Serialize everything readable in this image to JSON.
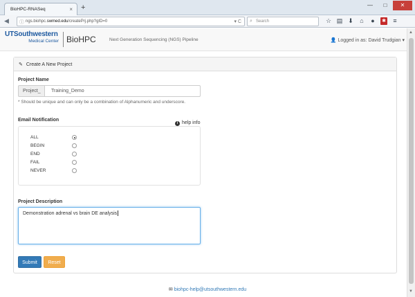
{
  "browser": {
    "tab_title": "BioHPC-RNASeq",
    "tab_close": "×",
    "new_tab": "+",
    "window_buttons": [
      "—",
      "□",
      "✕"
    ],
    "url_prefix": "ngs.biohpc.",
    "url_host": "swmed.edu",
    "url_path": "/createPrj.php?gID=0",
    "url_dropdown": "▾",
    "reload": "C",
    "search_placeholder": "Search",
    "toolbar_icons": [
      "star-icon",
      "clipboard-icon",
      "download-icon",
      "home-icon",
      "chat-icon",
      "addon-icon",
      "menu-icon"
    ]
  },
  "header": {
    "logo_ut": "UTSouthwestern",
    "logo_mc": "Medical Center",
    "brand": "BioHPC",
    "pipeline": "Next Generation Sequencing (NGS) Pipeline",
    "user": "Logged in as: David Trudgian"
  },
  "panel": {
    "title": "Create A New Project",
    "project_name_label": "Project Name",
    "prefix": "Project_",
    "project_name_value": "Training_Demo",
    "project_name_help": "* Should be unique and can only be a combination of Alphanumeric and underscore.",
    "email_label": "Email Notification",
    "help_info": "help info",
    "options": [
      "ALL",
      "BEGIN",
      "END",
      "FAIL",
      "NEVER"
    ],
    "selected_option": "ALL",
    "description_label": "Project Description",
    "description_value": "Demonstration adrenal vs brain DE analysis",
    "submit": "Submit",
    "reset": "Reset"
  },
  "footer": {
    "email": "biohpc-help@utsouthwestern.edu"
  }
}
